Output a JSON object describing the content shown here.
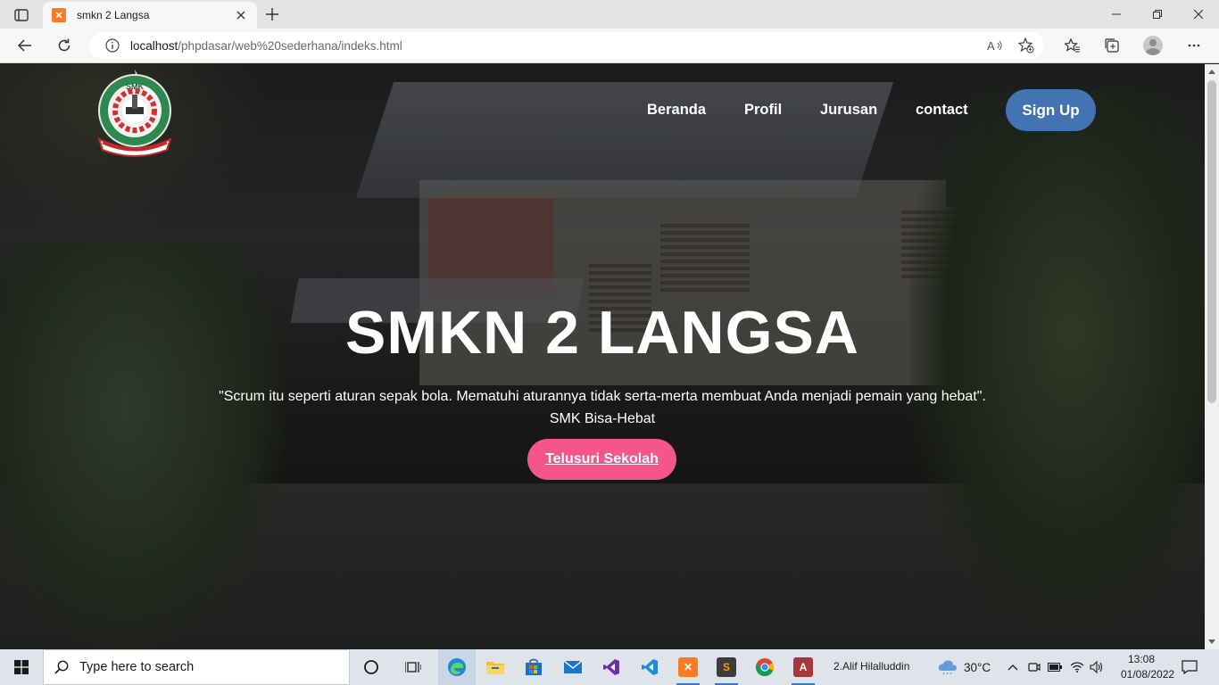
{
  "browser": {
    "tab_title": "smkn 2 Langsa",
    "url_host": "localhost",
    "url_path": "/phpdasar/web%20sederhana/indeks.html"
  },
  "site": {
    "nav": {
      "items": [
        "Beranda",
        "Profil",
        "Jurusan",
        "contact"
      ],
      "signup_label": "Sign Up"
    },
    "hero": {
      "title": "SMKN 2 LANGSA",
      "quote": "\"Scrum itu seperti aturan sepak bola. Mematuhi aturannya tidak serta-merta membuat Anda menjadi pemain yang hebat\".",
      "tagline": "SMK Bisa-Hebat",
      "cta_label": "Telusuri Sekolah"
    },
    "logo": {
      "icon": "school-crest-logo",
      "lettering": [
        "SMK",
        "MENENGAH KEJURUAN",
        "NEGERI 2",
        "LANGSA"
      ]
    },
    "colors": {
      "signup_bg": "#4273b3",
      "cta_bg": "#f4568b"
    }
  },
  "taskbar": {
    "search_placeholder": "Type here to search",
    "user_label": "2.Alif Hilalluddin",
    "temperature": "30°C",
    "time": "13:08",
    "date": "01/08/2022"
  }
}
